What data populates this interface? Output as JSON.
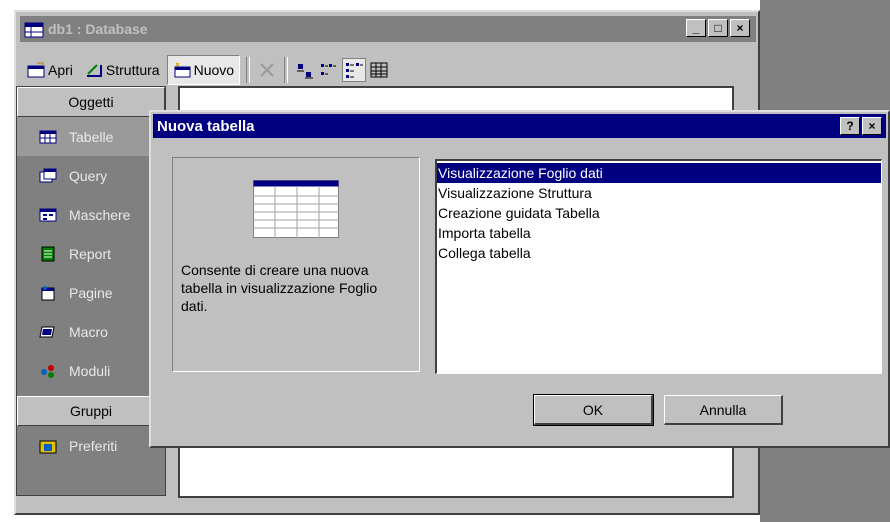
{
  "database_window": {
    "title": "db1 : Database",
    "window_buttons": [
      "_",
      "□",
      "×"
    ],
    "toolbar": {
      "open_label": "Apri",
      "design_label": "Struttura",
      "new_label": "Nuovo",
      "icons": [
        "delete-icon",
        "large-icons-icon",
        "small-icons-icon",
        "list-icon",
        "details-icon"
      ]
    },
    "sidebar": {
      "objects_header": "Oggetti",
      "items": [
        {
          "label": "Tabelle",
          "icon": "table-icon",
          "selected": true
        },
        {
          "label": "Query",
          "icon": "query-icon"
        },
        {
          "label": "Maschere",
          "icon": "form-icon"
        },
        {
          "label": "Report",
          "icon": "report-icon"
        },
        {
          "label": "Pagine",
          "icon": "page-icon"
        },
        {
          "label": "Macro",
          "icon": "macro-icon"
        },
        {
          "label": "Moduli",
          "icon": "module-icon"
        }
      ],
      "groups_header": "Gruppi",
      "favorites_label": "Preferiti"
    }
  },
  "dialog": {
    "title": "Nuova tabella",
    "help_button": "?",
    "close_button": "×",
    "description": "Consente di creare una nuova tabella in visualizzazione Foglio dati.",
    "options": [
      "Visualizzazione Foglio dati",
      "Visualizzazione Struttura",
      "Creazione guidata Tabella",
      "Importa tabella",
      "Collega tabella"
    ],
    "selected_option": "Visualizzazione Foglio dati",
    "ok_label": "OK",
    "cancel_label": "Annulla"
  },
  "colors": {
    "dialog_title_bar": "#000080",
    "inactive_title_bar": "#808080",
    "selection": "#000080",
    "face": "#c0c0c0"
  }
}
